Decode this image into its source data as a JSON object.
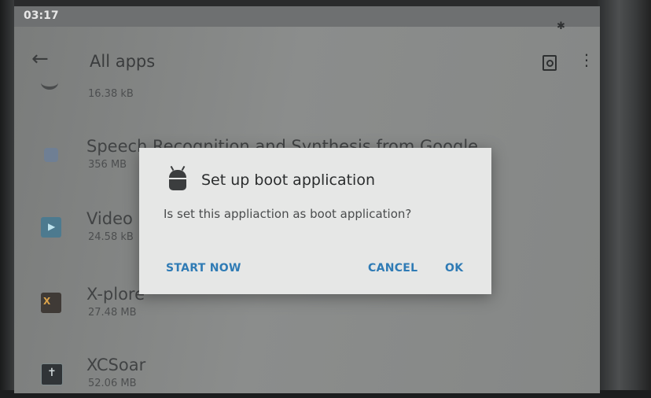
{
  "status_bar": {
    "time": "03:17",
    "bluetooth_icon": "bluetooth-icon"
  },
  "app_bar": {
    "title": "All apps",
    "back_icon": "arrow-left-icon",
    "search_icon": "app-search-icon",
    "menu_icon": "overflow-menu-icon"
  },
  "apps": [
    {
      "name": "",
      "size": "16.38 kB"
    },
    {
      "name": "Speech Recognition and Synthesis from Google",
      "size": "356 MB"
    },
    {
      "name": "Video",
      "size": "24.58 kB"
    },
    {
      "name": "X-plore",
      "size": "27.48 MB"
    },
    {
      "name": "XCSoar",
      "size": "52.06 MB"
    }
  ],
  "dialog": {
    "icon": "android-icon",
    "title": "Set up boot application",
    "message": "Is set this appliaction as boot application?",
    "start_label": "START NOW",
    "cancel_label": "CANCEL",
    "ok_label": "OK"
  },
  "colors": {
    "accent": "#2f7bb5",
    "dialog_bg": "#e6e7e6"
  }
}
